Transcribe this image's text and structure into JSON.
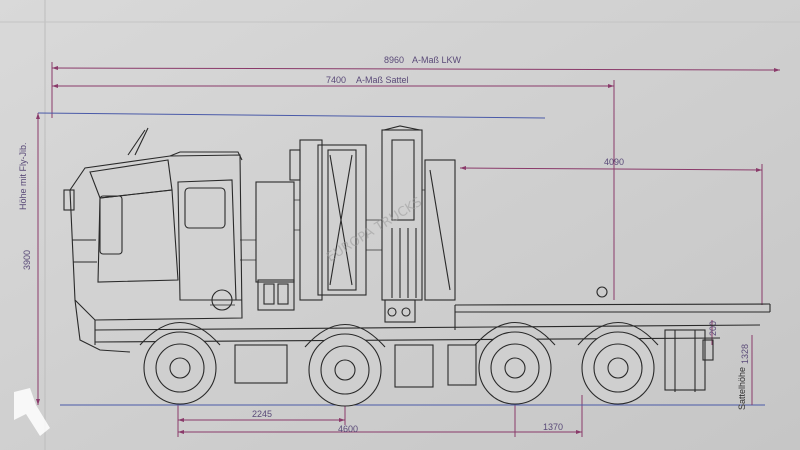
{
  "dimensions": {
    "a_mass_lkw_value": "8960",
    "a_mass_lkw_label": "A-Maß LKW",
    "a_mass_sattel_value": "7400",
    "a_mass_sattel_label": "A-Maß Sattel",
    "rear_length_value": "4090",
    "height_value": "3900",
    "height_label": "Höhe mit Fly-Jib.",
    "wheelbase_front_value": "2245",
    "wheelbase_total_value": "4600",
    "rear_axle_spacing_value": "1370",
    "saddle_height_value": "1328",
    "saddle_height_label": "Sattelhöhe",
    "small_dim_value": "200"
  },
  "watermark": {
    "text": "EUROPA TRUCKS"
  },
  "colors": {
    "dimension_line": "#8a3a6a",
    "dimension_line_blue": "#4a5aa8",
    "drawing_line": "#2a2a2a",
    "paper": "#d4d4d4"
  }
}
